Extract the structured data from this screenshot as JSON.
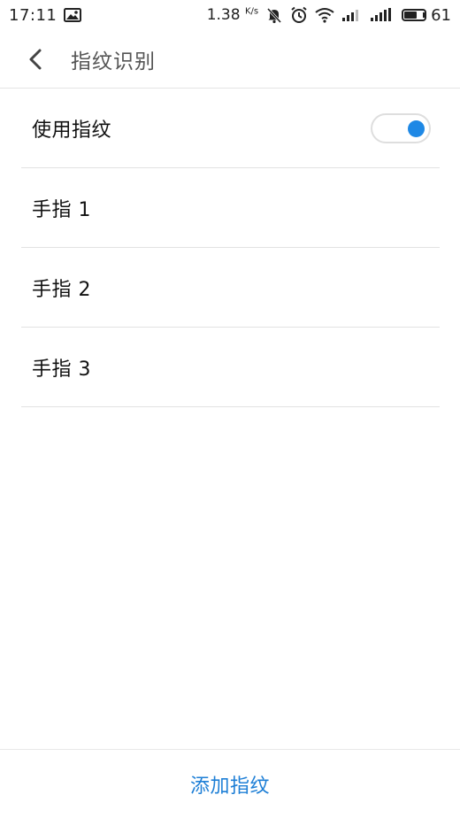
{
  "status_bar": {
    "time": "17:11",
    "net_speed": "1.38",
    "net_speed_unit": "K/s",
    "battery": "61",
    "battery_level": 0.61,
    "icons": [
      "image-icon",
      "notification-off-icon",
      "alarm-icon",
      "wifi-icon",
      "signal-icon",
      "signal-icon",
      "battery-icon"
    ]
  },
  "header": {
    "back_icon": "chevron-left-icon",
    "title": "指纹识别"
  },
  "settings": {
    "use_fingerprint": {
      "label": "使用指纹",
      "enabled": true,
      "accent_color": "#1e88e5"
    },
    "fingers": [
      {
        "label": "手指 1"
      },
      {
        "label": "手指 2"
      },
      {
        "label": "手指 3"
      }
    ]
  },
  "footer": {
    "add_label": "添加指纹",
    "accent_color": "#1e7fd6"
  }
}
